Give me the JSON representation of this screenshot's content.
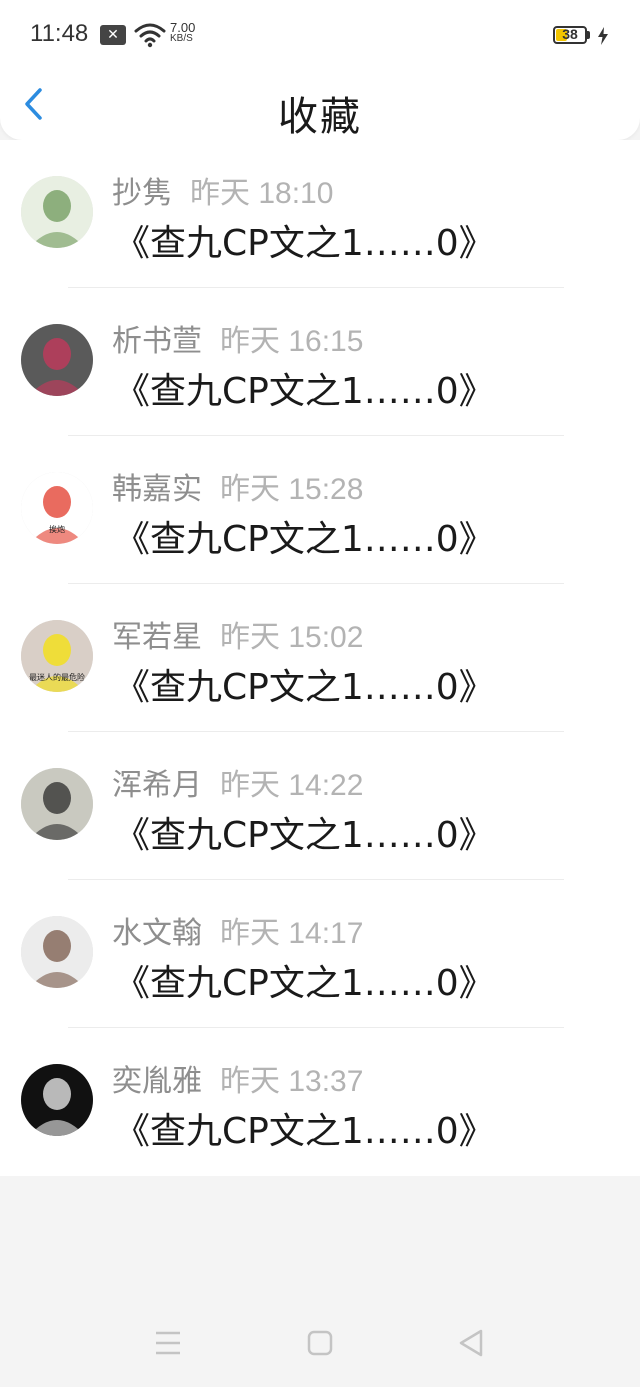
{
  "status_bar": {
    "time": "11:48",
    "net_speed_value": "7.00",
    "net_speed_unit": "KB/S",
    "battery": "38"
  },
  "header": {
    "title": "收藏",
    "back_icon": "chevron-left-icon"
  },
  "favorites": [
    {
      "name": "抄隽",
      "time": "昨天 18:10",
      "message": "《查九CP文之1……0》",
      "avatar_colors": [
        "#e8efe2",
        "#6f9a5b"
      ]
    },
    {
      "name": "析书萱",
      "time": "昨天 16:15",
      "message": "《查九CP文之1……0》",
      "avatar_colors": [
        "#5a5a5a",
        "#c9375c"
      ]
    },
    {
      "name": "韩嘉实",
      "time": "昨天 15:28",
      "message": "《查九CP文之1……0》",
      "avatar_colors": [
        "#ffffff",
        "#e23a2a"
      ],
      "avatar_text": "挨炮"
    },
    {
      "name": "军若星",
      "time": "昨天 15:02",
      "message": "《查九CP文之1……0》",
      "avatar_colors": [
        "#d9cfc7",
        "#f5e10a"
      ],
      "avatar_text": "最迷人的最危险"
    },
    {
      "name": "浑希月",
      "time": "昨天 14:22",
      "message": "《查九CP文之1……0》",
      "avatar_colors": [
        "#c9c9c0",
        "#2b2b2b"
      ]
    },
    {
      "name": "水文翰",
      "time": "昨天 14:17",
      "message": "《查九CP文之1……0》",
      "avatar_colors": [
        "#ececec",
        "#7a5a4a"
      ]
    },
    {
      "name": "奕胤雅",
      "time": "昨天 13:37",
      "message": "《查九CP文之1……0》",
      "avatar_colors": [
        "#111111",
        "#f2f2f2"
      ]
    }
  ],
  "bottom_nav": {
    "menu_icon": "menu-icon",
    "home_icon": "home-square-icon",
    "back_icon": "back-triangle-icon"
  },
  "colors": {
    "accent": "#2c8ce0",
    "name_text": "#8e8e8e",
    "time_text": "#b3b3b3",
    "message_text": "#1a1a1a",
    "background": "#f4f4f4"
  }
}
